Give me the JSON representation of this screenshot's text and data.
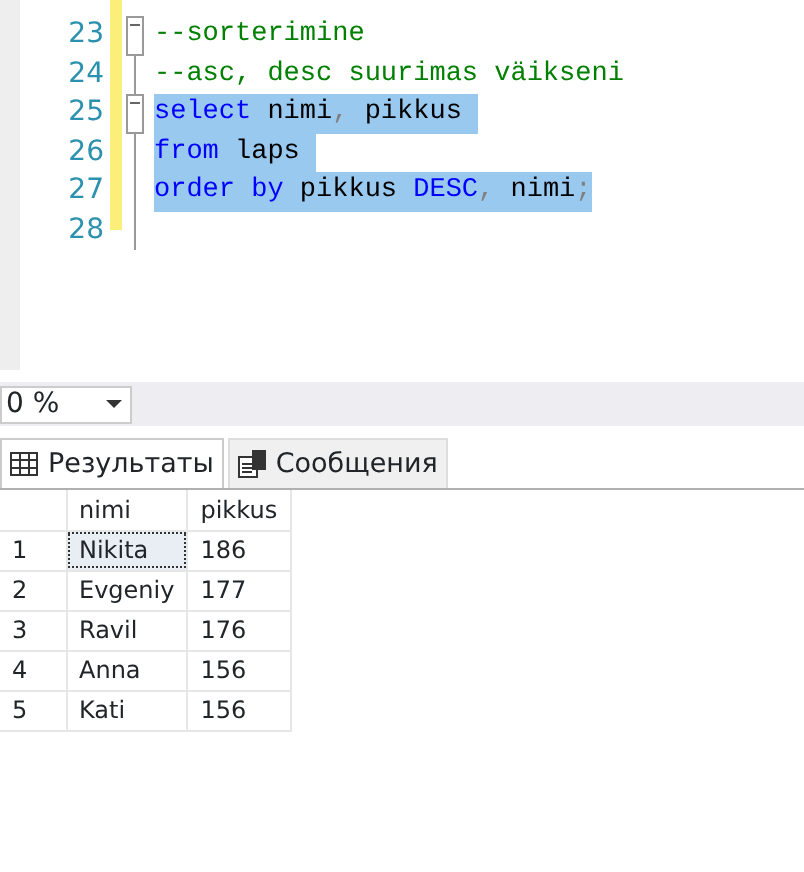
{
  "editor": {
    "lines": [
      {
        "number": "23",
        "fold_marker": true,
        "selected": false,
        "tokens": [
          {
            "text": "--sorterimine",
            "kind": "comment"
          }
        ]
      },
      {
        "number": "24",
        "fold_marker": false,
        "selected": false,
        "tokens": [
          {
            "text": "--asc, desc suurimas väikseni",
            "kind": "comment"
          }
        ]
      },
      {
        "number": "25",
        "fold_marker": true,
        "selected": true,
        "tokens": [
          {
            "text": "select",
            "kind": "keyword"
          },
          {
            "text": " nimi",
            "kind": "plain"
          },
          {
            "text": ",",
            "kind": "operator"
          },
          {
            "text": " pikkus ",
            "kind": "plain"
          }
        ]
      },
      {
        "number": "26",
        "fold_marker": false,
        "selected": true,
        "tokens": [
          {
            "text": "from",
            "kind": "keyword"
          },
          {
            "text": " laps ",
            "kind": "plain"
          }
        ]
      },
      {
        "number": "27",
        "fold_marker": false,
        "selected": true,
        "tokens": [
          {
            "text": "order by",
            "kind": "keyword"
          },
          {
            "text": " pikkus ",
            "kind": "plain"
          },
          {
            "text": "DESC",
            "kind": "keyword"
          },
          {
            "text": ",",
            "kind": "operator"
          },
          {
            "text": " nimi",
            "kind": "plain"
          },
          {
            "text": ";",
            "kind": "operator"
          }
        ]
      },
      {
        "number": "28",
        "fold_marker": false,
        "selected": false
      }
    ]
  },
  "zoom": {
    "value": "0 %"
  },
  "tabs": [
    {
      "label": "Результаты",
      "selected": true
    },
    {
      "label": "Сообщения",
      "selected": false
    }
  ],
  "results": {
    "columns": [
      "nimi",
      "pikkus"
    ],
    "rows": [
      {
        "number": "1",
        "cells": [
          "Nikita",
          "186"
        ],
        "selected": true
      },
      {
        "number": "2",
        "cells": [
          "Evgeniy",
          "177"
        ],
        "selected": false
      },
      {
        "number": "3",
        "cells": [
          "Ravil",
          "176"
        ],
        "selected": false
      },
      {
        "number": "4",
        "cells": [
          "Anna",
          "156"
        ],
        "selected": false
      },
      {
        "number": "5",
        "cells": [
          "Kati",
          "156"
        ],
        "selected": false
      }
    ]
  }
}
